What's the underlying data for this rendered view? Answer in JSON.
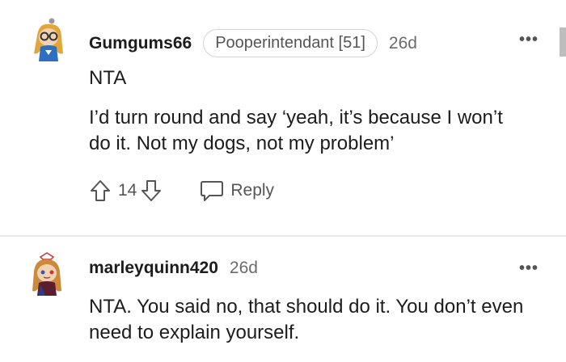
{
  "comments": [
    {
      "username": "Gumgums66",
      "flair": "Pooperintendant [51]",
      "time": "26d",
      "paragraphs": [
        "NTA",
        "I’d turn round and say ‘yeah, it’s because I won’t do it. Not my dogs, not my problem’"
      ],
      "votes": "14",
      "reply_label": "Reply",
      "more_label": "•••"
    },
    {
      "username": "marleyquinn420",
      "time": "26d",
      "paragraphs": [
        "NTA. You said no, that should do it. You don’t even need to explain yourself."
      ],
      "more_label": "•••"
    }
  ],
  "icons": {
    "upvote": "upvote-arrow-icon",
    "downvote": "downvote-arrow-icon",
    "reply": "speech-bubble-icon",
    "more": "more-options-icon"
  },
  "colors": {
    "text": "#1c1c1c",
    "meta": "#6b6b6b",
    "flair_border": "#d4d4d4",
    "divider": "#e9e9e9"
  }
}
